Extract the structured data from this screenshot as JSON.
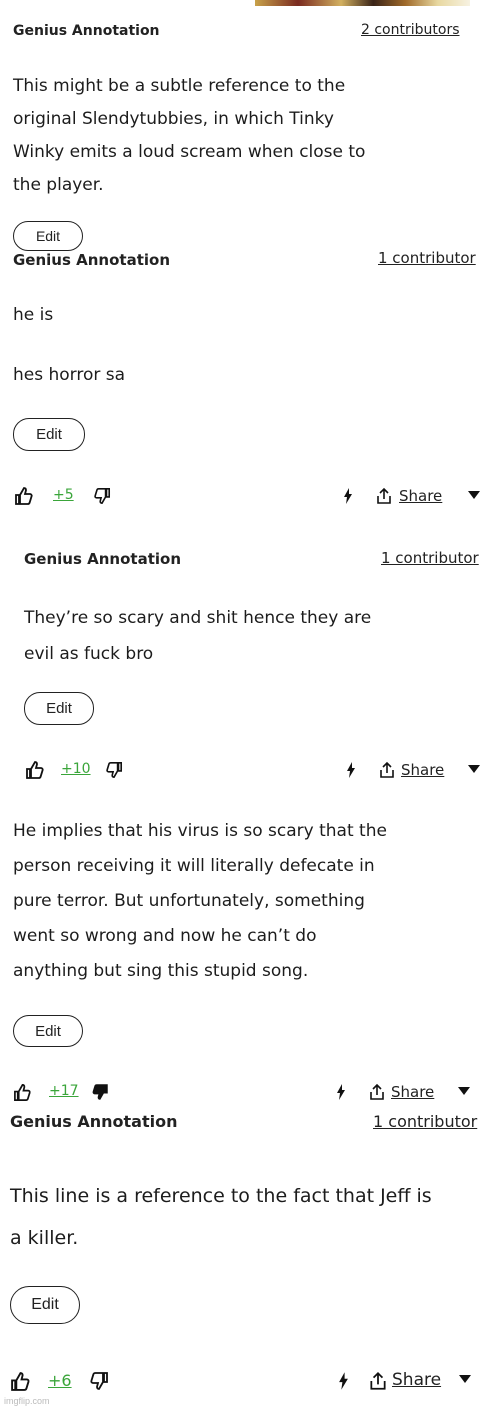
{
  "annotations": [
    {
      "header": "Genius Annotation",
      "contributors": "2 contributors",
      "body": [
        "This might be a subtle reference to the",
        "original Slendytubbies, in which Tinky",
        "Winky emits a loud scream when close to",
        "the player."
      ],
      "edit": "Edit"
    },
    {
      "header": "Genius Annotation",
      "contributors": "1 contributor",
      "body": [
        "he is",
        "",
        "hes horror sa"
      ],
      "edit": "Edit",
      "votes": "+5",
      "share": "Share"
    },
    {
      "header": "Genius Annotation",
      "contributors": "1 contributor",
      "body": [
        "They’re so scary and shit hence they are",
        "evil as fuck bro"
      ],
      "edit": "Edit",
      "votes": "+10",
      "share": "Share"
    },
    {
      "header": "",
      "contributors": "",
      "body": [
        "He implies that his virus is so scary that the",
        "person receiving it will literally defecate in",
        "pure terror. But unfortunately, something",
        "went so wrong and now he can’t do",
        "anything but sing this stupid song."
      ],
      "edit": "Edit",
      "votes": "+17",
      "share": "Share"
    },
    {
      "header": "Genius Annotation",
      "contributors": "1 contributor",
      "body": [
        "This line is a reference to the fact that Jeff is",
        "a killer."
      ],
      "edit": "Edit",
      "votes": "+6",
      "share": "Share"
    }
  ],
  "watermark": "imgflip.com",
  "icons": {
    "upvote": "thumbs-up-icon",
    "downvote": "thumbs-down-icon",
    "tip": "lightning-bolt-icon",
    "share": "share-upload-icon",
    "menu": "caret-down-icon"
  },
  "colors": {
    "votes": "#3aa53a",
    "text": "#1c1c1c"
  }
}
